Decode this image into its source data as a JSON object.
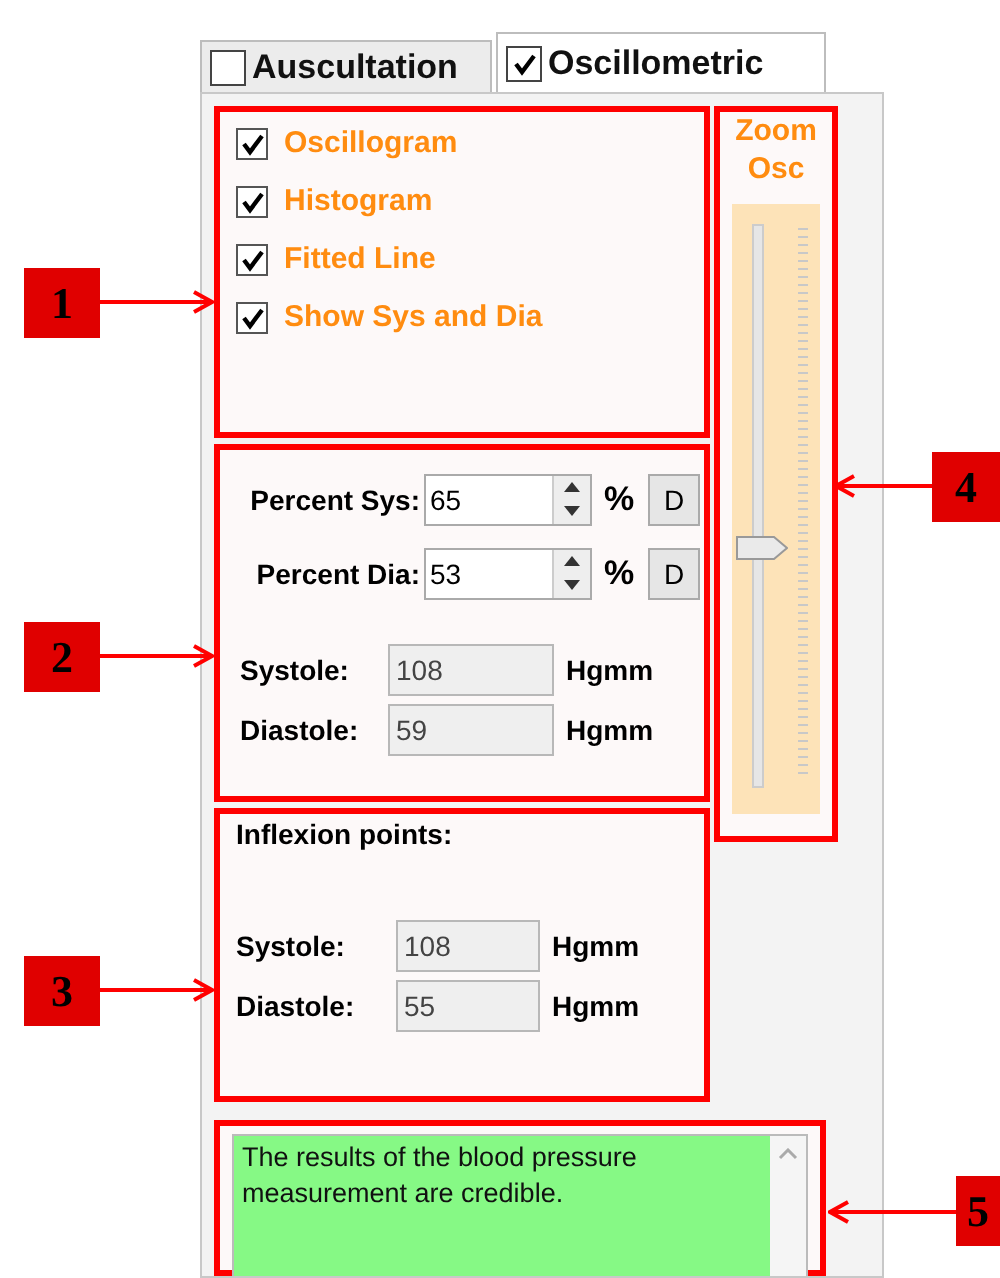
{
  "tabs": [
    {
      "label": "Auscultation",
      "checked": false,
      "selected": false
    },
    {
      "label": "Oscillometric",
      "checked": true,
      "selected": true
    }
  ],
  "display_options": [
    {
      "label": "Oscillogram",
      "checked": true
    },
    {
      "label": "Histogram",
      "checked": true
    },
    {
      "label": "Fitted Line",
      "checked": true
    },
    {
      "label": "Show Sys and Dia",
      "checked": true
    }
  ],
  "percent_fields": [
    {
      "label": "Percent Sys:",
      "value": "65",
      "unit": "%",
      "button": "D"
    },
    {
      "label": "Percent Dia:",
      "value": "53",
      "unit": "%",
      "button": "D"
    }
  ],
  "results": [
    {
      "label": "Systole:",
      "value": "108",
      "unit": "Hgmm"
    },
    {
      "label": "Diastole:",
      "value": "59",
      "unit": "Hgmm"
    }
  ],
  "inflexion": {
    "title": "Inflexion points:",
    "rows": [
      {
        "label": "Systole:",
        "value": "108",
        "unit": "Hgmm"
      },
      {
        "label": "Diastole:",
        "value": "55",
        "unit": "Hgmm"
      }
    ]
  },
  "zoom": {
    "title": "Zoom Osc",
    "level": 0.42
  },
  "message": {
    "text": "The results of the blood pressure measurement are credible.",
    "credible": true
  },
  "callouts": [
    {
      "label": "1",
      "kind": "left"
    },
    {
      "label": "2",
      "kind": "left"
    },
    {
      "label": "3",
      "kind": "left"
    },
    {
      "label": "4",
      "kind": "right"
    },
    {
      "label": "5",
      "kind": "right"
    }
  ]
}
